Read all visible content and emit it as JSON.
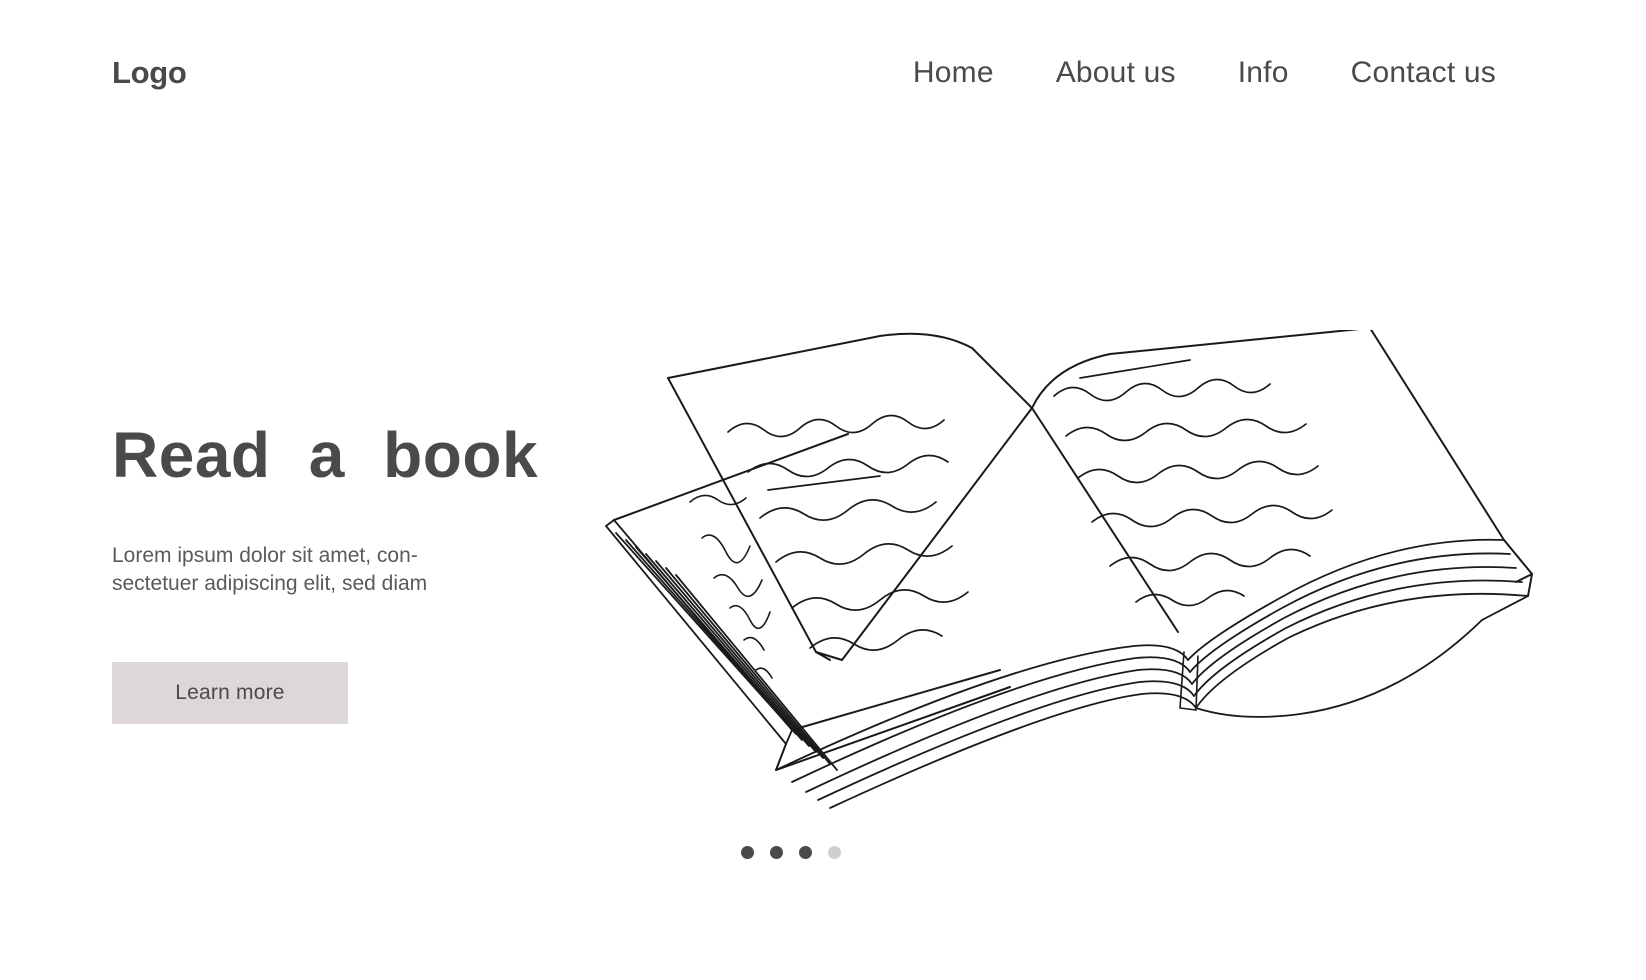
{
  "header": {
    "logo": "Logo",
    "nav": [
      {
        "label": "Home",
        "name": "nav-item-home"
      },
      {
        "label": "About us",
        "name": "nav-item-about-us"
      },
      {
        "label": "Info",
        "name": "nav-item-info"
      },
      {
        "label": "Contact us",
        "name": "nav-item-contact-us"
      }
    ]
  },
  "hero": {
    "title": "Read a book",
    "description_line1": "Lorem ipsum dolor sit amet, con-",
    "description_line2": "sectetuer adipiscing elit, sed diam",
    "cta_label": "Learn more",
    "illustration_name": "open-book-line-art"
  },
  "carousel": {
    "total_dots": 4,
    "active_dots": 3,
    "dots": [
      {
        "state": "active"
      },
      {
        "state": "active"
      },
      {
        "state": "active"
      },
      {
        "state": "inactive"
      }
    ]
  },
  "colors": {
    "background": "#ffffff",
    "text_dark": "#4a4a4d",
    "text_body": "#5a5a5e",
    "button_bg": "#ddd7d7",
    "dot_active": "#4a4a4d",
    "dot_inactive": "#d0cfcf",
    "line_art": "#1a1a1a"
  }
}
